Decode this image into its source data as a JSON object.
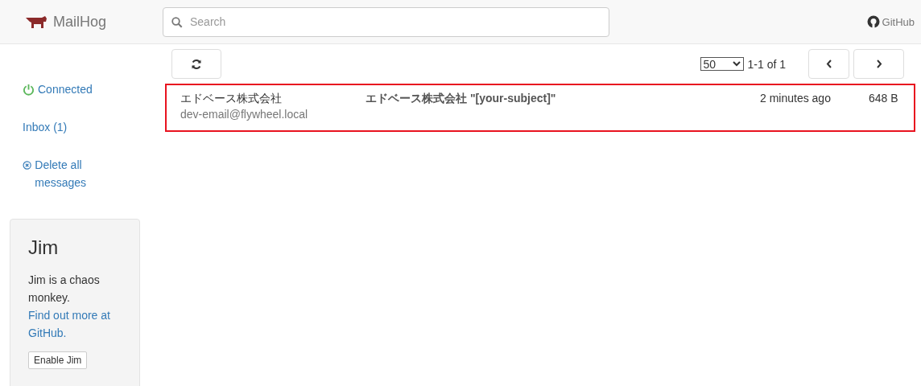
{
  "navbar": {
    "brand": "MailHog",
    "search": {
      "placeholder": "Search"
    },
    "github_link": "GitHub"
  },
  "sidebar": {
    "items": [
      {
        "kind": "status",
        "label": "Connected"
      },
      {
        "kind": "link",
        "label": "Inbox (1)"
      },
      {
        "kind": "delete",
        "label": "Delete all messages"
      }
    ],
    "jim": {
      "title": "Jim",
      "description": "Jim is a chaos monkey.",
      "link": "Find out more at GitHub.",
      "button": "Enable Jim"
    }
  },
  "toolbar": {
    "page_size": "50",
    "range": "1-1 of 1"
  },
  "messages": [
    {
      "from": "エドベース株式会社",
      "to": "dev-email@flywheel.local",
      "subject": "エドベース株式会社 \"[your-subject]\"",
      "time": "2 minutes ago",
      "size": "648 B",
      "highlighted": true
    }
  ]
}
